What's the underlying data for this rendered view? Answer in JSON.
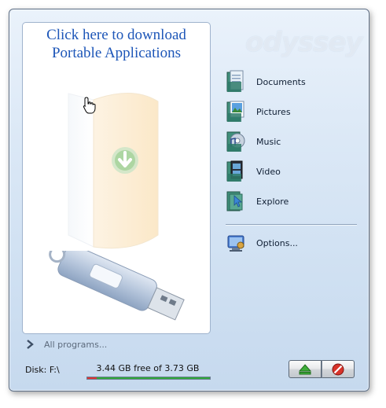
{
  "download_panel": {
    "line1": "Click here to download",
    "line2": "Portable Applications"
  },
  "brand": {
    "watermark_text": "odyssey"
  },
  "nav": {
    "items": [
      {
        "label": "Documents",
        "icon": "documents-icon"
      },
      {
        "label": "Pictures",
        "icon": "pictures-icon"
      },
      {
        "label": "Music",
        "icon": "music-icon"
      },
      {
        "label": "Video",
        "icon": "video-icon"
      },
      {
        "label": "Explore",
        "icon": "explore-icon"
      }
    ],
    "options": {
      "label": "Options...",
      "icon": "options-icon"
    }
  },
  "all_programs": {
    "label": "All programs..."
  },
  "status": {
    "disk_label": "Disk: F:\\",
    "free_text": "3.44 GB free of 3.73 GB",
    "used_fraction": 0.078
  },
  "colors": {
    "title_blue": "#1d56b8",
    "progress_free": "#2fa83a",
    "progress_used": "#dd3333"
  }
}
